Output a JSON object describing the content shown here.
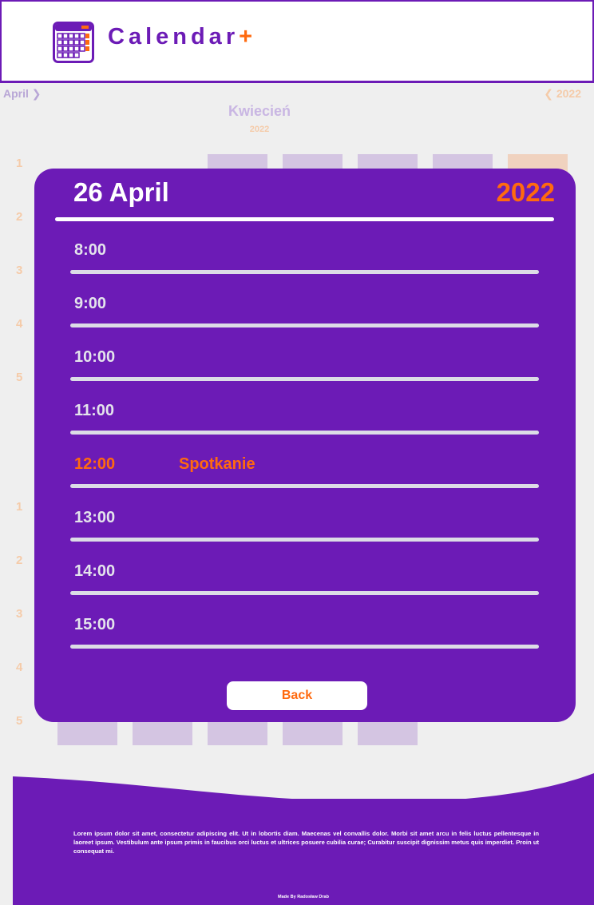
{
  "header": {
    "brand_name": "Calendar",
    "brand_plus": "+",
    "logo_icon": "calendar-icon"
  },
  "background_calendar": {
    "nav_month": "April",
    "nav_year": "2022",
    "title": "Kwiecień",
    "subtitle": "2022",
    "week_numbers_top": [
      "1",
      "2",
      "3",
      "4",
      "5"
    ],
    "week_numbers_bottom": [
      "1",
      "2",
      "3",
      "4",
      "5"
    ]
  },
  "day_view": {
    "date": "26 April",
    "year": "2022",
    "slots": [
      {
        "time": "8:00",
        "event": ""
      },
      {
        "time": "9:00",
        "event": ""
      },
      {
        "time": "10:00",
        "event": ""
      },
      {
        "time": "11:00",
        "event": ""
      },
      {
        "time": "12:00",
        "event": "Spotkanie"
      },
      {
        "time": "13:00",
        "event": ""
      },
      {
        "time": "14:00",
        "event": ""
      },
      {
        "time": "15:00",
        "event": ""
      }
    ],
    "back_label": "Back"
  },
  "footer": {
    "text": "Lorem ipsum dolor sit amet, consectetur adipiscing elit. Ut in lobortis diam. Maecenas vel convallis dolor. Morbi sit amet arcu in felis luctus pellentesque in laoreet ipsum. Vestibulum ante ipsum primis in faucibus orci luctus et ultrices posuere cubilia curae; Curabitur suscipit dignissim metus quis imperdiet. Proin ut consequat mi.",
    "credits": "Made By Radosław Drab"
  },
  "colors": {
    "primary": "#6c1bb6",
    "accent": "#ff6a0f",
    "background": "#efefef"
  }
}
